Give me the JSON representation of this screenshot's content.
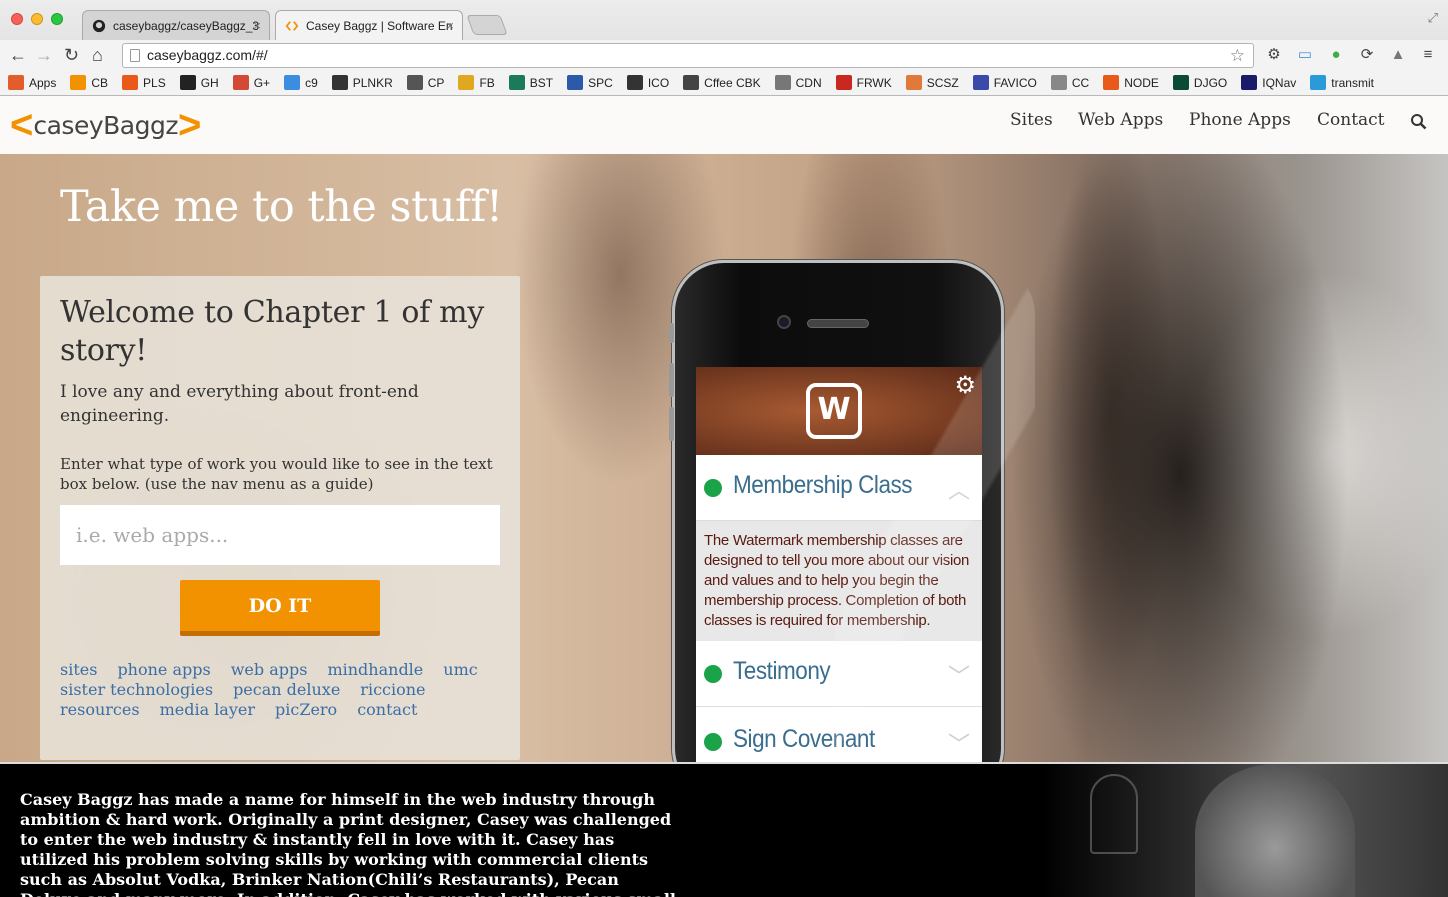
{
  "browser": {
    "tabs": [
      {
        "title": "caseybaggz/caseyBaggz_3",
        "close": "×"
      },
      {
        "title": "Casey Baggz | Software En",
        "close": "×"
      }
    ],
    "url": "caseybaggz.com/#/",
    "bookmarks": [
      {
        "label": "Apps",
        "icon": "apps-grid-icon",
        "color": "#e35c2c"
      },
      {
        "label": "CB",
        "icon": "cb-icon",
        "color": "#f39200"
      },
      {
        "label": "PLS",
        "icon": "play-icon",
        "color": "#e8591a"
      },
      {
        "label": "GH",
        "icon": "github-icon",
        "color": "#222222"
      },
      {
        "label": "G+",
        "icon": "gplus-icon",
        "color": "#d34836"
      },
      {
        "label": "c9",
        "icon": "cloud-icon",
        "color": "#3b8de0"
      },
      {
        "label": "PLNKR",
        "icon": "plunker-icon",
        "color": "#333333"
      },
      {
        "label": "CP",
        "icon": "codepen-icon",
        "color": "#555555"
      },
      {
        "label": "FB",
        "icon": "database-icon",
        "color": "#e0a820"
      },
      {
        "label": "BST",
        "icon": "bst-icon",
        "color": "#1a7a5a"
      },
      {
        "label": "SPC",
        "icon": "spc-icon",
        "color": "#2a5aa8"
      },
      {
        "label": "ICO",
        "icon": "ico-icon",
        "color": "#333333"
      },
      {
        "label": "Cffee CBK",
        "icon": "book-icon",
        "color": "#444444"
      },
      {
        "label": "CDN",
        "icon": "cdn-icon",
        "color": "#777777"
      },
      {
        "label": "FRWK",
        "icon": "frwk-icon",
        "color": "#c8281e"
      },
      {
        "label": "SCSZ",
        "icon": "scsz-icon",
        "color": "#e07a3a"
      },
      {
        "label": "FAVICO",
        "icon": "favico-icon",
        "color": "#3a4aa8"
      },
      {
        "label": "CC",
        "icon": "cc-icon",
        "color": "#888888"
      },
      {
        "label": "NODE",
        "icon": "node-icon",
        "color": "#e8591a"
      },
      {
        "label": "DJGO",
        "icon": "django-icon",
        "color": "#0c4b33"
      },
      {
        "label": "IQNav",
        "icon": "iqnav-icon",
        "color": "#1a1a6a"
      },
      {
        "label": "transmit",
        "icon": "transmit-icon",
        "color": "#2a9ad8"
      }
    ]
  },
  "site": {
    "logo": {
      "left": "<",
      "text": "caseyBaggz",
      "right": ">"
    },
    "nav": [
      "Sites",
      "Web Apps",
      "Phone Apps",
      "Contact"
    ],
    "hero_title": "Take me to the stuff!",
    "card": {
      "heading": "Welcome to Chapter 1 of my story!",
      "lead": "I love any and everything about front-end engineering.",
      "instructions": "Enter what type of work you would like to see in the text box below. (use the nav menu as a guide)",
      "input_placeholder": "i.e. web apps...",
      "button": "DO IT",
      "links": [
        "sites",
        "phone apps",
        "web apps",
        "mindhandle",
        "umc",
        "sister technologies",
        "pecan deluxe",
        "riccione",
        "resources",
        "media layer",
        "picZero",
        "contact"
      ]
    },
    "phone": {
      "logo_letter": "W",
      "accordion": [
        {
          "label": "Membership Class",
          "chevron": "︿"
        },
        {
          "label": "Testimony",
          "chevron": "﹀"
        },
        {
          "label": "Sign Covenant",
          "chevron": "﹀"
        }
      ],
      "body": "The Watermark membership classes are designed to tell you more about our vision and values and to help you begin the membership process. Completion of both classes is required for membership."
    },
    "about": "Casey Baggz has made a name for himself in the web industry through ambition & hard work. Originally a print designer, Casey was challenged to enter the web industry & instantly fell in love with it. Casey has utilized his problem solving skills by working with commercial clients such as Absolut Vodka, Brinker Nation(Chili’s Restaurants), Pecan Deluxe and many more. In addition, Casey has worked with various small businesses & non-profits"
  },
  "colors": {
    "accent": "#f39200",
    "link": "#3a6ea5",
    "status_green": "#1aa348"
  }
}
